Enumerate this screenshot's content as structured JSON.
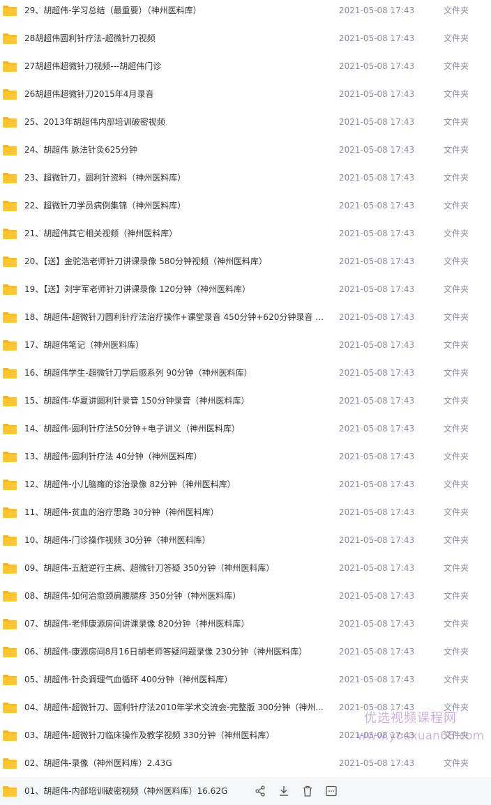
{
  "files": [
    {
      "name": "29、胡超伟-学习总结（最重要）（神州医料库）",
      "date": "2021-05-08 17:43",
      "type": "文件夹"
    },
    {
      "name": "28胡超伟圆利针疗法-超微针刀视频",
      "date": "2021-05-08 17:43",
      "type": "文件夹"
    },
    {
      "name": "27胡超伟超微针刀视频---胡超伟门诊",
      "date": "2021-05-08 17:43",
      "type": "文件夹"
    },
    {
      "name": "26胡超伟超微针刀2015年4月录音",
      "date": "2021-05-08 17:43",
      "type": "文件夹"
    },
    {
      "name": "25、2013年胡超伟内部培训破密视频",
      "date": "2021-05-08 17:43",
      "type": "文件夹"
    },
    {
      "name": "24、胡超伟 脉法针灸625分钟",
      "date": "2021-05-08 17:43",
      "type": "文件夹"
    },
    {
      "name": "23、超微针刀，圆利针资料（神州医料库）",
      "date": "2021-05-08 17:43",
      "type": "文件夹"
    },
    {
      "name": "22、超微针刀学员病例集锦（神州医料库）",
      "date": "2021-05-08 17:43",
      "type": "文件夹"
    },
    {
      "name": "21、胡超伟其它相关视频（神州医料库）",
      "date": "2021-05-08 17:43",
      "type": "文件夹"
    },
    {
      "name": "20、【送】金驼浩老师针刀讲课录像 580分钟视频（神州医料库）",
      "date": "2021-05-08 17:43",
      "type": "文件夹"
    },
    {
      "name": "19、【送】刘宇军老师针刀讲课录像 120分钟（神州医料库）",
      "date": "2021-05-08 17:43",
      "type": "文件夹"
    },
    {
      "name": "18、胡超伟-超微针刀圆利针疗法治疗操作+课堂录音 450分钟+620分钟录音 （...",
      "date": "2021-05-08 17:43",
      "type": "文件夹"
    },
    {
      "name": "17、胡超伟笔记（神州医料库）",
      "date": "2021-05-08 17:43",
      "type": "文件夹"
    },
    {
      "name": "16、胡超伟学生-超微针刀学后感系列 90分钟（神州医料库）",
      "date": "2021-05-08 17:43",
      "type": "文件夹"
    },
    {
      "name": "15、胡超伟-华夏讲圆利针录音 150分钟录音（神州医料库）",
      "date": "2021-05-08 17:43",
      "type": "文件夹"
    },
    {
      "name": "14、胡超伟-圆利针疗法50分钟+电子讲义（神州医料库）",
      "date": "2021-05-08 17:43",
      "type": "文件夹"
    },
    {
      "name": "13、胡超伟-圆利针疗法 40分钟（神州医料库）",
      "date": "2021-05-08 17:43",
      "type": "文件夹"
    },
    {
      "name": "12、胡超伟-小儿脑瘫的诊治录像 82分钟（神州医料库）",
      "date": "2021-05-08 17:43",
      "type": "文件夹"
    },
    {
      "name": "11、胡超伟-贫血的治疗思路 30分钟（神州医料库）",
      "date": "2021-05-08 17:43",
      "type": "文件夹"
    },
    {
      "name": "10、胡超伟-门诊操作视频 30分钟（神州医料库）",
      "date": "2021-05-08 17:43",
      "type": "文件夹"
    },
    {
      "name": "09、胡超伟-五脏逆行主病、超微针刀答疑 350分钟（神州医料库）",
      "date": "2021-05-08 17:43",
      "type": "文件夹"
    },
    {
      "name": "08、胡超伟-如何治愈颈肩腰腿疼 350分钟（神州医料库）",
      "date": "2021-05-08 17:43",
      "type": "文件夹"
    },
    {
      "name": "07、胡超伟-老师康源房间讲课录像 820分钟（神州医料库）",
      "date": "2021-05-08 17:43",
      "type": "文件夹"
    },
    {
      "name": "06、胡超伟-康源房间8月16日胡老师答疑问题录像 230分钟（神州医料库）",
      "date": "2021-05-08 17:43",
      "type": "文件夹"
    },
    {
      "name": "05、胡超伟-针灸调理气血循环 400分钟（神州医料库）",
      "date": "2021-05-08 17:43",
      "type": "文件夹"
    },
    {
      "name": "04、胡超伟-超微针刀、圆利针疗法2010年学术交流会-完整版 300分钟（神州...",
      "date": "2021-05-08 17:43",
      "type": "文件夹"
    },
    {
      "name": "03、胡超伟-超微针刀临床操作及教学视频 330分钟（神州医料库）",
      "date": "2021-05-08 17:43",
      "type": "文件夹"
    },
    {
      "name": "02、胡超伟-录像（神州医料库）2.43G",
      "date": "2021-05-08 17:43",
      "type": "文件夹"
    },
    {
      "name": "01、胡超伟-内部培训破密视频（神州医料库）16.62G",
      "date": "",
      "type": "",
      "hovered": true
    }
  ],
  "row_actions": [
    {
      "name": "share-icon"
    },
    {
      "name": "download-icon"
    },
    {
      "name": "delete-icon"
    },
    {
      "name": "more-icon"
    }
  ],
  "watermark": {
    "cn": "优选视频课程网",
    "en": "www.youxuan68.com"
  },
  "colors": {
    "folder": "#ffc634",
    "folder_tab": "#f5b82a",
    "name_text": "#333333",
    "meta_text": "#878c9c",
    "hover_bg": "#f5f6f7"
  }
}
